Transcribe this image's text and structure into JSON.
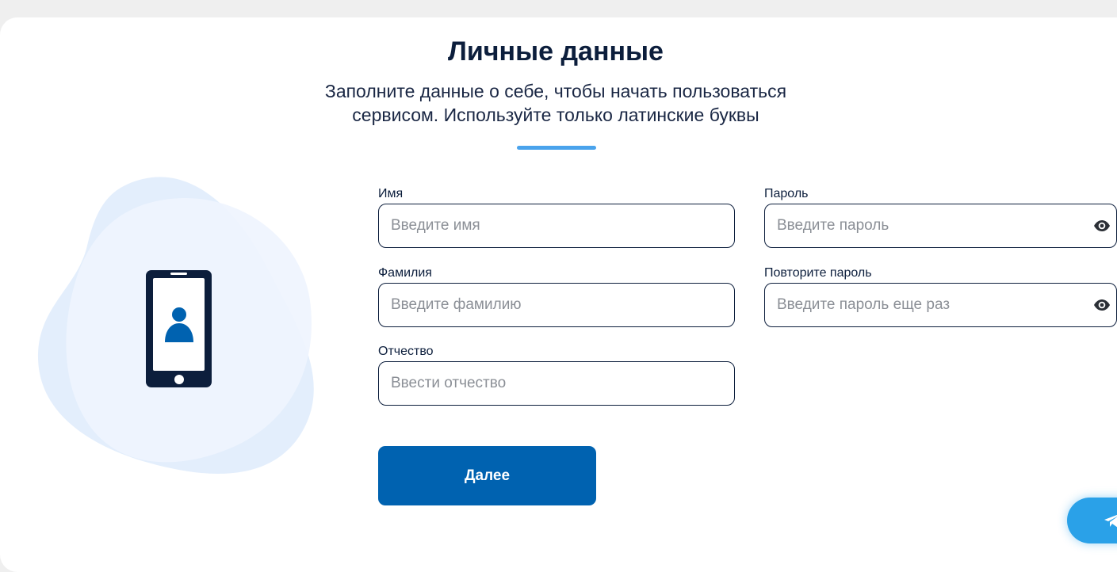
{
  "page": {
    "title": "Личные данные",
    "subtitle_line1": "Заполните данные о себе, чтобы начать пользоваться",
    "subtitle_line2": "сервисом. Используйте только латинские буквы"
  },
  "form": {
    "first_name": {
      "label": "Имя",
      "placeholder": "Введите имя"
    },
    "last_name": {
      "label": "Фамилия",
      "placeholder": "Введите фамилию"
    },
    "patronymic": {
      "label": "Отчество",
      "placeholder": "Ввести отчество"
    },
    "password": {
      "label": "Пароль",
      "placeholder": "Введите пароль",
      "icon": "eye-icon"
    },
    "password_repeat": {
      "label": "Повторите пароль",
      "placeholder": "Введите пароль еще раз",
      "icon": "eye-icon"
    },
    "submit_label": "Далее"
  },
  "illustration": {
    "icon": "phone-user-icon"
  },
  "chat": {
    "icon": "telegram-icon"
  },
  "colors": {
    "primary": "#0062b0",
    "accent": "#4aa3ec",
    "text": "#0c1e3c",
    "blob": "#e3eefc",
    "chat": "#2aa1e8"
  }
}
